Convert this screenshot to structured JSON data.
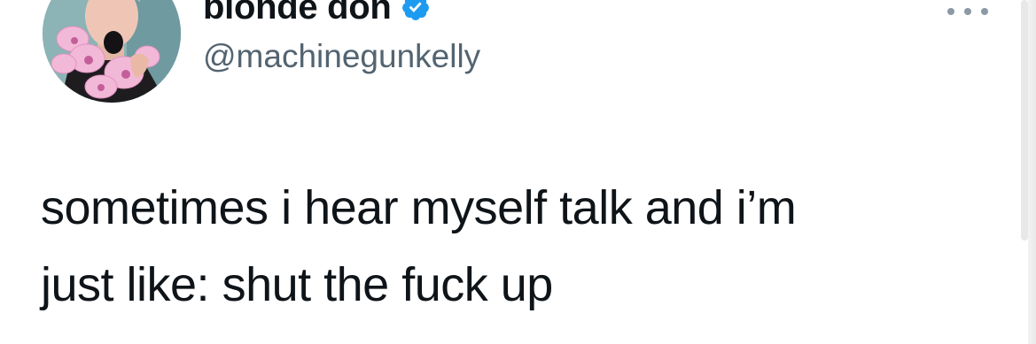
{
  "tweet": {
    "author": {
      "display_name": "blonde don",
      "handle": "@machinegunkelly",
      "verified": true,
      "verified_color": "#1d9bf0"
    },
    "text_lines": [
      "sometimes i hear myself talk and i’m",
      "just like: shut the fuck up"
    ]
  },
  "icons": {
    "verified": "verified-badge-icon",
    "more": "more-options-icon"
  },
  "colors": {
    "text_primary": "#0f1419",
    "text_secondary": "#536471",
    "accent": "#1d9bf0"
  }
}
